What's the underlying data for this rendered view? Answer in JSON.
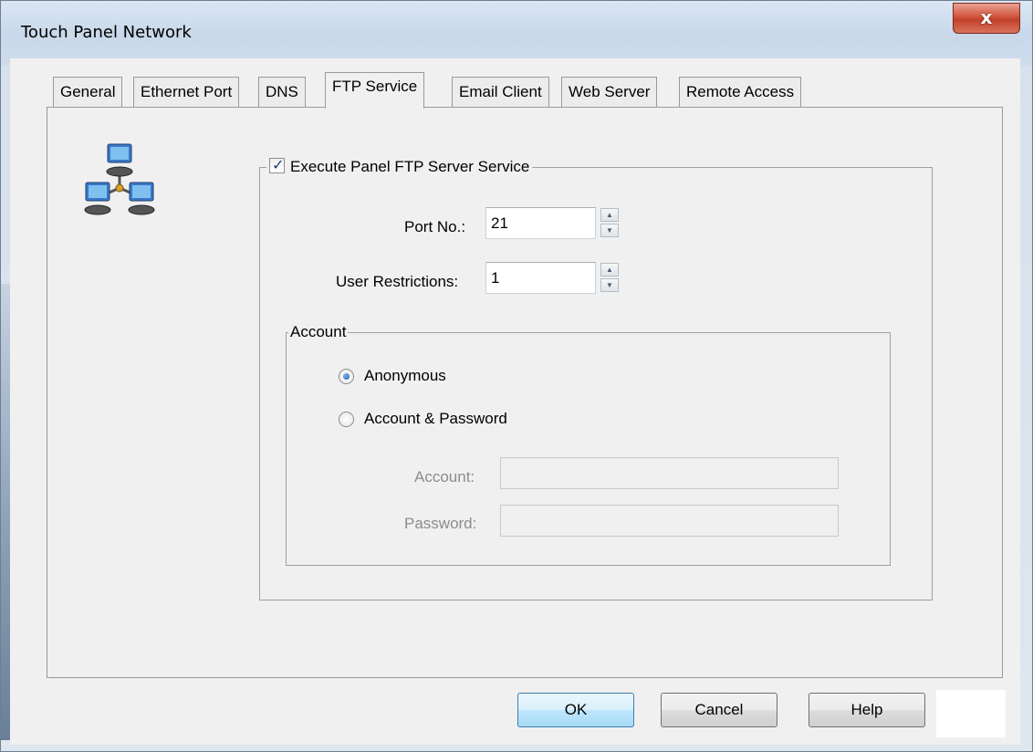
{
  "window": {
    "title": "Touch Panel Network",
    "close_glyph": "x"
  },
  "tabs": [
    {
      "label": "General"
    },
    {
      "label": "Ethernet Port"
    },
    {
      "label": "DNS"
    },
    {
      "label": "FTP Service",
      "active": true
    },
    {
      "label": "Email Client"
    },
    {
      "label": "Web Server"
    },
    {
      "label": "Remote Access"
    }
  ],
  "icon": "network-computers-icon",
  "ftp": {
    "enable_label": "Execute Panel FTP Server Service",
    "enable_checked": true,
    "port_label": "Port No.:",
    "port_value": "21",
    "users_label": "User Restrictions:",
    "users_value": "1",
    "account_group_label": "Account",
    "anonymous_label": "Anonymous",
    "anonymous_selected": true,
    "account_password_label": "Account & Password",
    "account_field_label": "Account:",
    "account_field_value": "",
    "password_field_label": "Password:",
    "password_field_value": ""
  },
  "buttons": {
    "ok": "OK",
    "cancel": "Cancel",
    "help": "Help"
  },
  "colors": {
    "close_button": "#c9452f",
    "default_button": "#bee6fd",
    "checkmark": "#1d3f78"
  }
}
